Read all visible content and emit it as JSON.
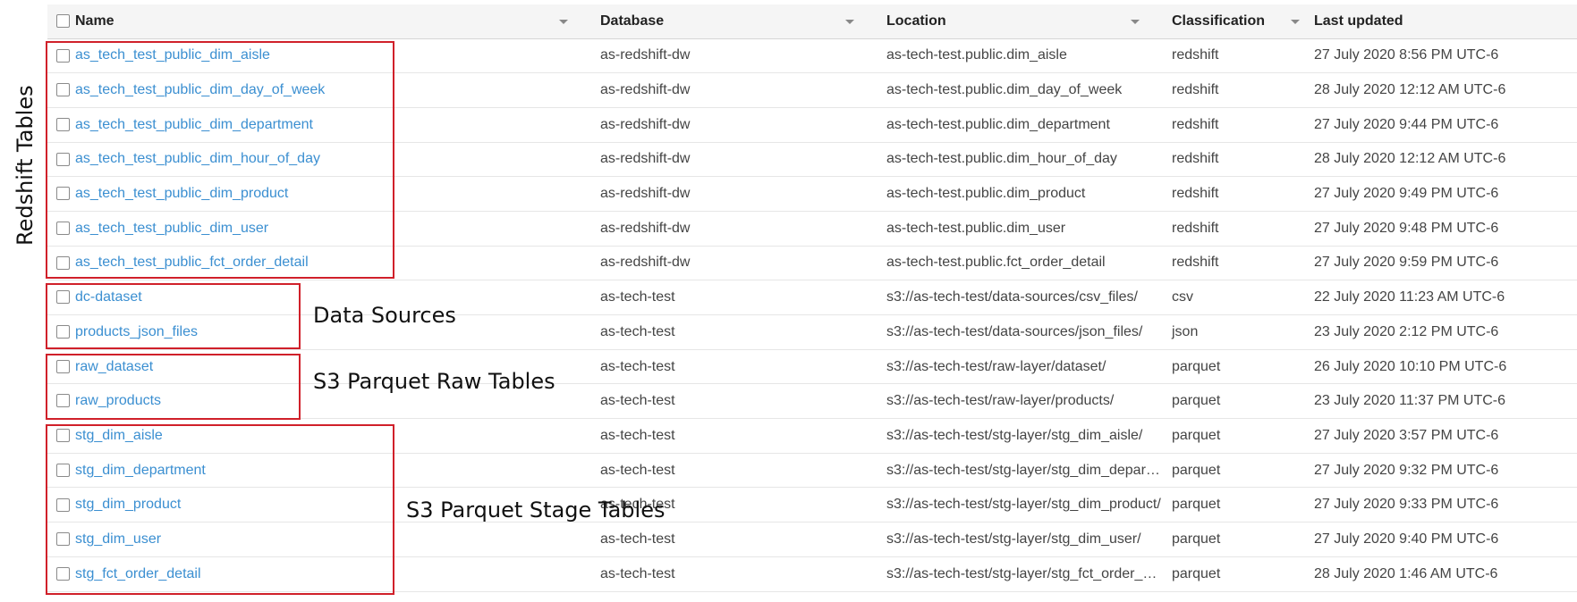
{
  "columns": {
    "name": "Name",
    "database": "Database",
    "location": "Location",
    "classification": "Classification",
    "last_updated": "Last updated"
  },
  "rows": [
    {
      "name": "as_tech_test_public_dim_aisle",
      "database": "as-redshift-dw",
      "location": "as-tech-test.public.dim_aisle",
      "classification": "redshift",
      "last_updated": "27 July 2020 8:56 PM UTC-6"
    },
    {
      "name": "as_tech_test_public_dim_day_of_week",
      "database": "as-redshift-dw",
      "location": "as-tech-test.public.dim_day_of_week",
      "classification": "redshift",
      "last_updated": "28 July 2020 12:12 AM UTC-6"
    },
    {
      "name": "as_tech_test_public_dim_department",
      "database": "as-redshift-dw",
      "location": "as-tech-test.public.dim_department",
      "classification": "redshift",
      "last_updated": "27 July 2020 9:44 PM UTC-6"
    },
    {
      "name": "as_tech_test_public_dim_hour_of_day",
      "database": "as-redshift-dw",
      "location": "as-tech-test.public.dim_hour_of_day",
      "classification": "redshift",
      "last_updated": "28 July 2020 12:12 AM UTC-6"
    },
    {
      "name": "as_tech_test_public_dim_product",
      "database": "as-redshift-dw",
      "location": "as-tech-test.public.dim_product",
      "classification": "redshift",
      "last_updated": "27 July 2020 9:49 PM UTC-6"
    },
    {
      "name": "as_tech_test_public_dim_user",
      "database": "as-redshift-dw",
      "location": "as-tech-test.public.dim_user",
      "classification": "redshift",
      "last_updated": "27 July 2020 9:48 PM UTC-6"
    },
    {
      "name": "as_tech_test_public_fct_order_detail",
      "database": "as-redshift-dw",
      "location": "as-tech-test.public.fct_order_detail",
      "classification": "redshift",
      "last_updated": "27 July 2020 9:59 PM UTC-6"
    },
    {
      "name": "dc-dataset",
      "database": "as-tech-test",
      "location": "s3://as-tech-test/data-sources/csv_files/",
      "classification": "csv",
      "last_updated": "22 July 2020 11:23 AM UTC-6"
    },
    {
      "name": "products_json_files",
      "database": "as-tech-test",
      "location": "s3://as-tech-test/data-sources/json_files/",
      "classification": "json",
      "last_updated": "23 July 2020 2:12 PM UTC-6"
    },
    {
      "name": "raw_dataset",
      "database": "as-tech-test",
      "location": "s3://as-tech-test/raw-layer/dataset/",
      "classification": "parquet",
      "last_updated": "26 July 2020 10:10 PM UTC-6"
    },
    {
      "name": "raw_products",
      "database": "as-tech-test",
      "location": "s3://as-tech-test/raw-layer/products/",
      "classification": "parquet",
      "last_updated": "23 July 2020 11:37 PM UTC-6"
    },
    {
      "name": "stg_dim_aisle",
      "database": "as-tech-test",
      "location": "s3://as-tech-test/stg-layer/stg_dim_aisle/",
      "classification": "parquet",
      "last_updated": "27 July 2020 3:57 PM UTC-6"
    },
    {
      "name": "stg_dim_department",
      "database": "as-tech-test",
      "location": "s3://as-tech-test/stg-layer/stg_dim_depart…",
      "classification": "parquet",
      "last_updated": "27 July 2020 9:32 PM UTC-6"
    },
    {
      "name": "stg_dim_product",
      "database": "as-tech-test",
      "location": "s3://as-tech-test/stg-layer/stg_dim_product/",
      "classification": "parquet",
      "last_updated": "27 July 2020 9:33 PM UTC-6"
    },
    {
      "name": "stg_dim_user",
      "database": "as-tech-test",
      "location": "s3://as-tech-test/stg-layer/stg_dim_user/",
      "classification": "parquet",
      "last_updated": "27 July 2020 9:40 PM UTC-6"
    },
    {
      "name": "stg_fct_order_detail",
      "database": "as-tech-test",
      "location": "s3://as-tech-test/stg-layer/stg_fct_order_de…",
      "classification": "parquet",
      "last_updated": "28 July 2020 1:46 AM UTC-6"
    }
  ],
  "annotations": {
    "redshift": "Redshift Tables",
    "data_sources": "Data Sources",
    "raw": "S3 Parquet Raw Tables",
    "stage": "S3 Parquet Stage Tables"
  },
  "colors": {
    "link": "#3b8fd1",
    "highlight_box": "#d0202a",
    "header_bg": "#f5f5f5"
  }
}
